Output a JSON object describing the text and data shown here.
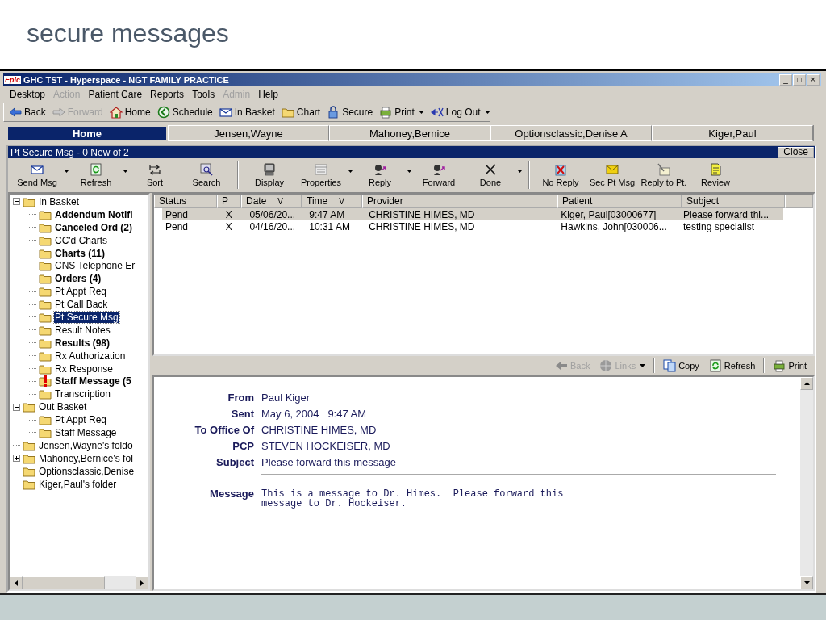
{
  "slide_title": "secure messages",
  "window": {
    "logo": "Epic",
    "title": "GHC TST - Hyperspace - NGT FAMILY PRACTICE",
    "controls": [
      "_",
      "□",
      "×"
    ]
  },
  "menu": [
    {
      "label": "Desktop",
      "disabled": false
    },
    {
      "label": "Action",
      "disabled": true
    },
    {
      "label": "Patient Care",
      "disabled": false
    },
    {
      "label": "Reports",
      "disabled": false
    },
    {
      "label": "Tools",
      "disabled": false
    },
    {
      "label": "Admin",
      "disabled": true
    },
    {
      "label": "Help",
      "disabled": false
    }
  ],
  "toolbar": [
    {
      "label": "Back",
      "disabled": false,
      "dropdown": false
    },
    {
      "label": "Forward",
      "disabled": true,
      "dropdown": false
    },
    {
      "label": "Home",
      "disabled": false,
      "dropdown": false
    },
    {
      "label": "Schedule",
      "disabled": false,
      "dropdown": false
    },
    {
      "label": "In Basket",
      "disabled": false,
      "dropdown": false
    },
    {
      "label": "Chart",
      "disabled": false,
      "dropdown": false
    },
    {
      "label": "Secure",
      "disabled": false,
      "dropdown": false
    },
    {
      "label": "Print",
      "disabled": false,
      "dropdown": true
    },
    {
      "label": "Log Out",
      "disabled": false,
      "dropdown": true
    }
  ],
  "patient_tabs": [
    {
      "label": "Home",
      "selected": true
    },
    {
      "label": "Jensen,Wayne",
      "selected": false
    },
    {
      "label": "Mahoney,Bernice",
      "selected": false
    },
    {
      "label": "Optionsclassic,Denise A",
      "selected": false
    },
    {
      "label": "Kiger,Paul",
      "selected": false
    }
  ],
  "activity": {
    "title": "Pt Secure Msg - 0 New of 2",
    "close": "Close",
    "toolbar_groups": [
      [
        {
          "label": "Send Msg",
          "dropdown": true
        },
        {
          "label": "Refresh",
          "dropdown": true
        },
        {
          "label": "Sort",
          "dropdown": false
        },
        {
          "label": "Search",
          "dropdown": false
        }
      ],
      [
        {
          "label": "Display",
          "dropdown": false
        },
        {
          "label": "Properties",
          "dropdown": true
        },
        {
          "label": "Reply",
          "dropdown": true
        },
        {
          "label": "Forward",
          "dropdown": false
        },
        {
          "label": "Done",
          "dropdown": true
        }
      ],
      [
        {
          "label": "No Reply",
          "dropdown": false
        },
        {
          "label": "Sec Pt Msg",
          "dropdown": false
        },
        {
          "label": "Reply to Pt.",
          "dropdown": false
        },
        {
          "label": "Review",
          "dropdown": false
        }
      ]
    ]
  },
  "folders": [
    {
      "label": "In Basket",
      "bold": false,
      "selected": false,
      "expanded": true,
      "children": [
        {
          "label": "Addendum Notifi",
          "bold": true,
          "selected": false
        },
        {
          "label": "Canceled Ord (2)",
          "bold": true,
          "selected": false
        },
        {
          "label": "CC'd Charts",
          "bold": false,
          "selected": false
        },
        {
          "label": "Charts (11)",
          "bold": true,
          "selected": false
        },
        {
          "label": "CNS Telephone Er",
          "bold": false,
          "selected": false
        },
        {
          "label": "Orders (4)",
          "bold": true,
          "selected": false
        },
        {
          "label": "Pt Appt Req",
          "bold": false,
          "selected": false
        },
        {
          "label": "Pt Call Back",
          "bold": false,
          "selected": false
        },
        {
          "label": "Pt Secure Msg",
          "bold": false,
          "selected": true
        },
        {
          "label": "Result Notes",
          "bold": false,
          "selected": false
        },
        {
          "label": "Results (98)",
          "bold": true,
          "selected": false
        },
        {
          "label": "Rx Authorization",
          "bold": false,
          "selected": false
        },
        {
          "label": "Rx Response",
          "bold": false,
          "selected": false
        },
        {
          "label": "Staff Message (5",
          "bold": true,
          "selected": false,
          "flagged": true
        },
        {
          "label": "Transcription",
          "bold": false,
          "selected": false
        }
      ]
    },
    {
      "label": "Out Basket",
      "bold": false,
      "selected": false,
      "expanded": true,
      "children": [
        {
          "label": "Pt Appt Req",
          "bold": false,
          "selected": false
        },
        {
          "label": "Staff Message",
          "bold": false,
          "selected": false
        }
      ]
    },
    {
      "label": "Jensen,Wayne's foldo",
      "bold": false,
      "selected": false
    },
    {
      "label": "Mahoney,Bernice's fol",
      "bold": false,
      "selected": false,
      "expanded": false
    },
    {
      "label": "Optionsclassic,Denise",
      "bold": false,
      "selected": false
    },
    {
      "label": "Kiger,Paul's folder",
      "bold": false,
      "selected": false
    }
  ],
  "messages": {
    "columns": [
      {
        "label": "Status"
      },
      {
        "label": "P"
      },
      {
        "label": "Date",
        "sort_mark": "V"
      },
      {
        "label": "Time",
        "sort_mark": "V"
      },
      {
        "label": "Provider"
      },
      {
        "label": "Patient"
      },
      {
        "label": "Subject"
      }
    ],
    "rows": [
      {
        "selected": true,
        "cells": [
          "Pend",
          "X",
          "05/06/20...",
          "9:47 AM",
          "CHRISTINE HIMES, MD",
          "Kiger, Paul[03000677]",
          "Please forward thi..."
        ]
      },
      {
        "selected": false,
        "cells": [
          "Pend",
          "X",
          "04/16/20...",
          "10:31 AM",
          "CHRISTINE HIMES, MD",
          "Hawkins, John[030006...",
          "testing specialist"
        ]
      }
    ]
  },
  "preview_toolbar": [
    {
      "label": "Back",
      "disabled": true,
      "dropdown": false
    },
    {
      "label": "Links",
      "disabled": true,
      "dropdown": true
    },
    {
      "label": "Copy",
      "disabled": false,
      "dropdown": false
    },
    {
      "label": "Refresh",
      "disabled": false,
      "dropdown": false
    },
    {
      "label": "Print",
      "disabled": false,
      "dropdown": false
    }
  ],
  "preview": {
    "fields": [
      {
        "label": "From",
        "value": "Paul Kiger"
      },
      {
        "label": "Sent",
        "value": "May 6, 2004   9:47 AM"
      },
      {
        "label": "To Office Of",
        "value": "CHRISTINE HIMES, MD"
      },
      {
        "label": "PCP",
        "value": "STEVEN HOCKEISER, MD"
      },
      {
        "label": "Subject",
        "value": "Please forward this message"
      }
    ],
    "message_label": "Message",
    "message": "This is a message to Dr. Himes.  Please forward this\nmessage to Dr. Hockeiser."
  }
}
